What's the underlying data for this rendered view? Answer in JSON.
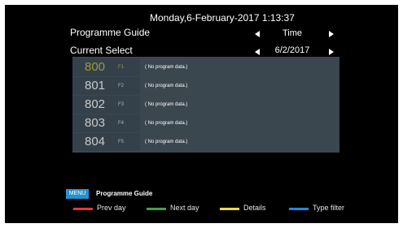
{
  "header": {
    "datetime": "Monday,6-February-2017 1:13:37",
    "programme_guide_label": "Programme Guide",
    "current_select_label": "Current Select",
    "time_value": "Time",
    "date_value": "6/2/2017"
  },
  "channels": [
    {
      "number": "800",
      "key": "F1",
      "program": "( No program data.)"
    },
    {
      "number": "801",
      "key": "F2",
      "program": "( No program data.)"
    },
    {
      "number": "802",
      "key": "F3",
      "program": "( No program data.)"
    },
    {
      "number": "803",
      "key": "F4",
      "program": "( No program data.)"
    },
    {
      "number": "804",
      "key": "F5",
      "program": "( No program data.)"
    }
  ],
  "footer": {
    "menu_badge": "MENU",
    "menu_title": "Programme Guide",
    "legend": [
      {
        "label": "Prev day",
        "color": "#e53935"
      },
      {
        "label": "Next day",
        "color": "#43a047"
      },
      {
        "label": "Details",
        "color": "#fdd835"
      },
      {
        "label": "Type filter",
        "color": "#1e88e5"
      }
    ]
  },
  "colors": {
    "selected_channel": "#9a9a3a",
    "list_background": "#3b474f",
    "menu_badge": "#2591d1"
  }
}
